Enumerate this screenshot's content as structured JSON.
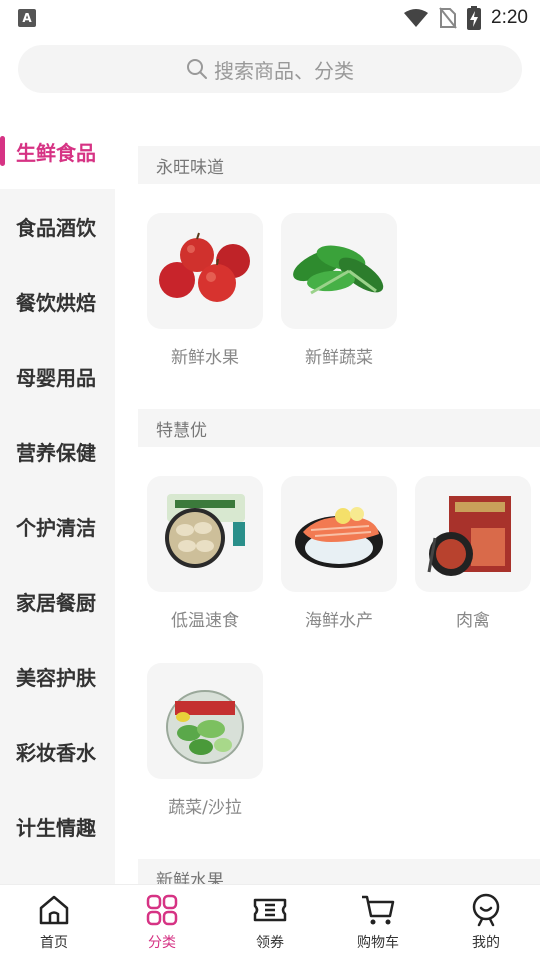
{
  "status_bar": {
    "app_badge": "A",
    "time": "2:20"
  },
  "search": {
    "placeholder": "搜索商品、分类"
  },
  "sidebar": {
    "items": [
      {
        "label": "生鲜食品",
        "active": true
      },
      {
        "label": "食品酒饮"
      },
      {
        "label": "餐饮烘焙"
      },
      {
        "label": "母婴用品"
      },
      {
        "label": "营养保健"
      },
      {
        "label": "个护清洁"
      },
      {
        "label": "家居餐厨"
      },
      {
        "label": "美容护肤"
      },
      {
        "label": "彩妆香水"
      },
      {
        "label": "计生情趣"
      }
    ]
  },
  "sections": [
    {
      "title": "永旺味道",
      "items": [
        {
          "label": "新鲜水果"
        },
        {
          "label": "新鲜蔬菜"
        }
      ]
    },
    {
      "title": "特慧优",
      "items": [
        {
          "label": "低温速食"
        },
        {
          "label": "海鲜水产"
        },
        {
          "label": "肉禽"
        },
        {
          "label": "蔬菜/沙拉"
        }
      ]
    },
    {
      "title": "新鲜水果",
      "items": []
    }
  ],
  "bottom_nav": {
    "items": [
      {
        "label": "首页",
        "icon": "home-icon"
      },
      {
        "label": "分类",
        "icon": "category-icon",
        "active": true
      },
      {
        "label": "领券",
        "icon": "coupon-icon"
      },
      {
        "label": "购物车",
        "icon": "cart-icon"
      },
      {
        "label": "我的",
        "icon": "profile-icon"
      }
    ]
  },
  "colors": {
    "accent": "#d63384",
    "panel": "#f5f5f5"
  }
}
